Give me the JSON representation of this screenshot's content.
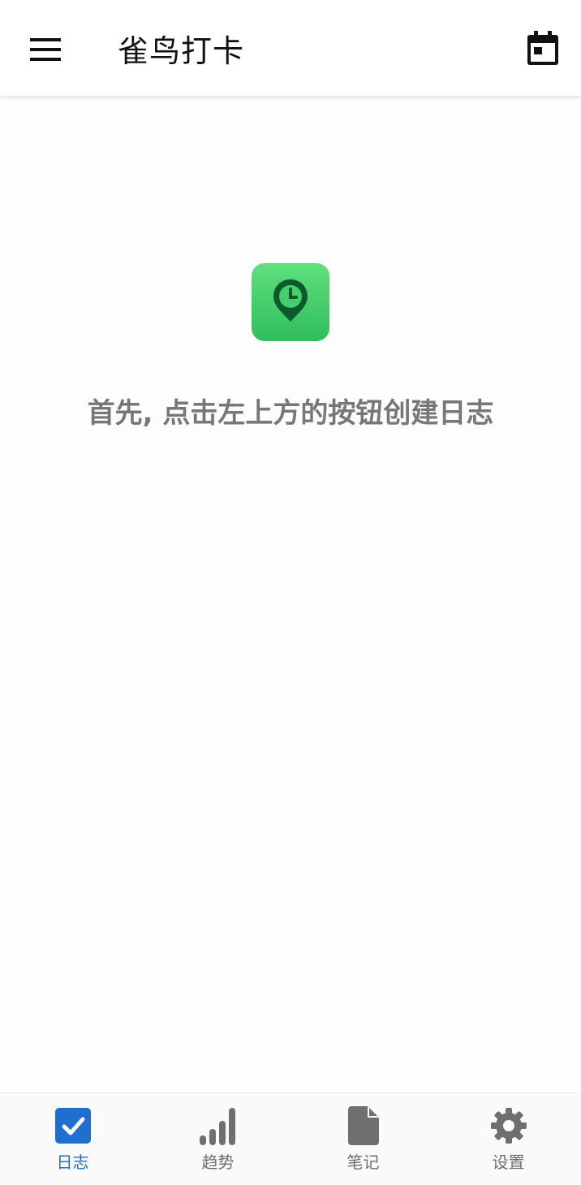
{
  "appbar": {
    "title": "雀鸟打卡",
    "menu_icon": "menu-icon",
    "calendar_icon": "calendar-today-icon"
  },
  "empty_state": {
    "icon": "location-clock-icon",
    "hint": "首先, 点击左上方的按钮创建日志"
  },
  "bottom_nav": {
    "items": [
      {
        "label": "日志",
        "icon": "checkbox-icon",
        "active": true
      },
      {
        "label": "趋势",
        "icon": "signal-bars-icon",
        "active": false
      },
      {
        "label": "笔记",
        "icon": "document-icon",
        "active": false
      },
      {
        "label": "设置",
        "icon": "gear-icon",
        "active": false
      }
    ]
  },
  "colors": {
    "accent": "#1f6fd0",
    "app_icon_green": "#3ccf66",
    "text_muted": "#777777"
  }
}
